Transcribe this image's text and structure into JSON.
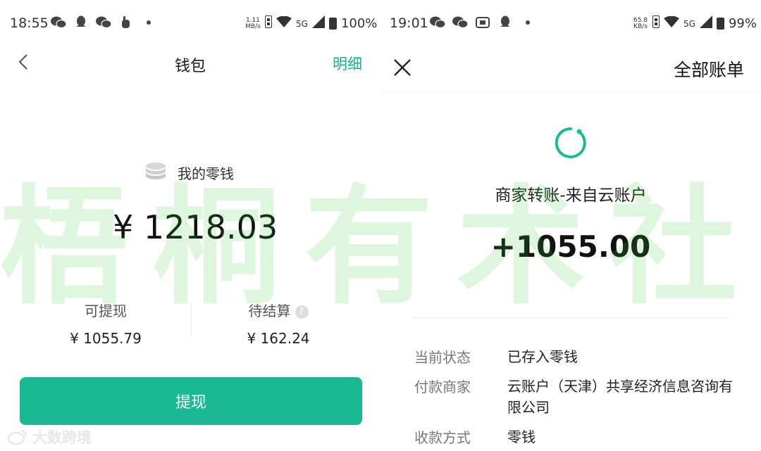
{
  "left": {
    "status": {
      "time": "18:55",
      "app_icons": [
        "wechat-icon",
        "qq-icon",
        "wechat-icon",
        "hand-icon",
        "dot-icon"
      ],
      "net_speed": "1.11\nMB/s",
      "signal": "5G",
      "battery": "100%"
    },
    "header": {
      "title": "钱包",
      "detail_link": "明细"
    },
    "wallet": {
      "label": "我的零钱",
      "balance": "¥ 1218.03"
    },
    "withdrawable": {
      "title": "可提现",
      "value": "¥ 1055.79"
    },
    "pending": {
      "title": "待结算",
      "value": "¥ 162.24"
    },
    "button": {
      "label": "提现"
    }
  },
  "right": {
    "status": {
      "time": "19:01",
      "app_icons": [
        "wechat-icon",
        "wechat-icon",
        "taobao-icon",
        "qq-icon",
        "dot-icon"
      ],
      "net_speed": "65.8\nKB/s",
      "signal": "5G",
      "battery": "99%"
    },
    "header": {
      "bills_link": "全部账单"
    },
    "transaction": {
      "merchant": "商家转账-来自云账户",
      "amount": "+1055.00",
      "rows": [
        {
          "key": "当前状态",
          "value": "已存入零钱"
        },
        {
          "key": "付款商家",
          "value": "云账户（天津）共享经济信息咨询有限公司"
        },
        {
          "key": "收款方式",
          "value": "零钱"
        }
      ]
    }
  },
  "watermark": {
    "text": "梧桐有术社群",
    "corner_logo": "大数跨境"
  },
  "colors": {
    "accent": "#1ab994",
    "watermark": "#7fd97f"
  }
}
